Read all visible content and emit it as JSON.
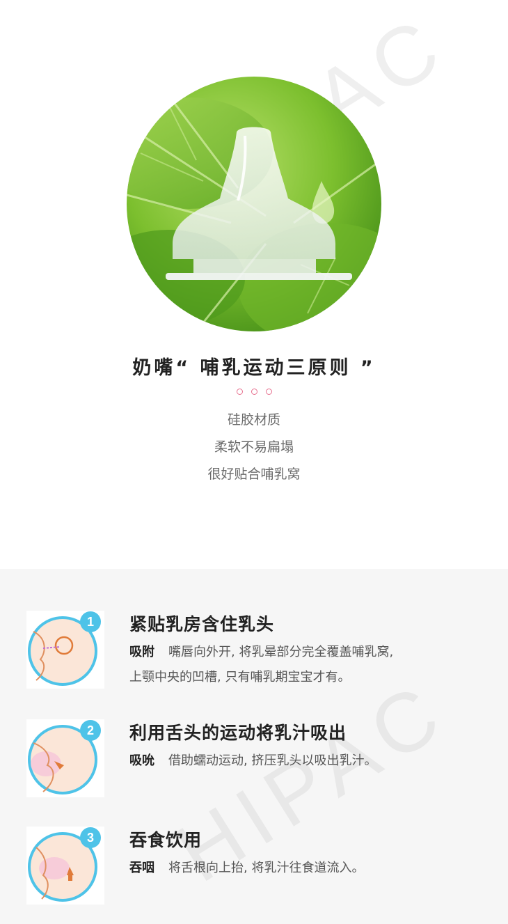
{
  "watermark": "HIPAC",
  "hero": {
    "heading": "奶嘴“ 哺乳运动三原则 ”",
    "lines": [
      "硅胶材质",
      "柔软不易扁塌",
      "很好贴合哺乳窝"
    ]
  },
  "steps": [
    {
      "number": "1",
      "title": "紧贴乳房含住乳头",
      "keyword": "吸附",
      "desc_line1": "嘴唇向外开, 将乳晕部分完全覆盖哺乳窝,",
      "desc_line2": "上颚中央的凹槽, 只有哺乳期宝宝才有。"
    },
    {
      "number": "2",
      "title": "利用舌头的运动将乳汁吸出",
      "keyword": "吸吮",
      "desc_line1": "借助蠕动运动, 挤压乳头以吸出乳汁。"
    },
    {
      "number": "3",
      "title": "吞食饮用",
      "keyword": "吞咽",
      "desc_line1": "将舌根向上抬, 将乳汁往食道流入。"
    }
  ],
  "colors": {
    "accent_pink": "#e7708f",
    "step_blue": "#4ec3e8",
    "leaf_green": "#7cbf2e",
    "skin": "#fce3d3"
  }
}
